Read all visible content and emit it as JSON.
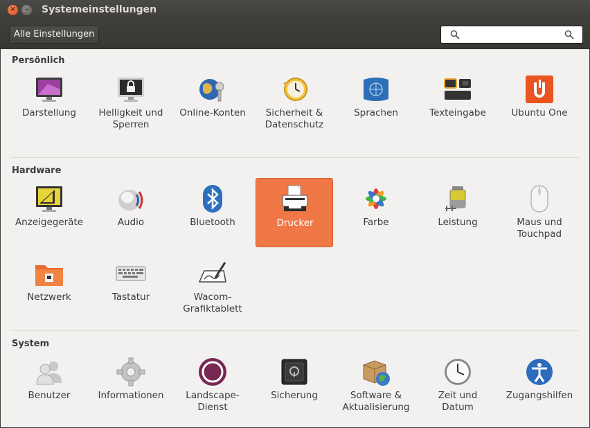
{
  "window": {
    "title": "Systemeinstellungen",
    "close_glyph": "×",
    "minimize_glyph": "–"
  },
  "toolbar": {
    "all_settings_label": "Alle Einstellungen",
    "search_placeholder": "",
    "search_value": ""
  },
  "sections": {
    "personal": {
      "title": "Persönlich",
      "items": [
        {
          "icon": "appearance-icon",
          "label": [
            "Darstellung"
          ]
        },
        {
          "icon": "brightness-lock-icon",
          "label": [
            "Helligkeit und",
            "Sperren"
          ]
        },
        {
          "icon": "online-accounts-icon",
          "label": [
            "Online-Konten"
          ]
        },
        {
          "icon": "security-privacy-icon",
          "label": [
            "Sicherheit &",
            "Datenschutz"
          ]
        },
        {
          "icon": "languages-icon",
          "label": [
            "Sprachen"
          ]
        },
        {
          "icon": "text-entry-icon",
          "label": [
            "Texteingabe"
          ]
        },
        {
          "icon": "ubuntu-one-icon",
          "label": [
            "Ubuntu One"
          ]
        }
      ]
    },
    "hardware": {
      "title": "Hardware",
      "items": [
        {
          "icon": "displays-icon",
          "label": [
            "Anzeigegeräte"
          ]
        },
        {
          "icon": "audio-icon",
          "label": [
            "Audio"
          ]
        },
        {
          "icon": "bluetooth-icon",
          "label": [
            "Bluetooth"
          ]
        },
        {
          "icon": "printer-icon",
          "label": [
            "Drucker"
          ],
          "selected": true
        },
        {
          "icon": "color-icon",
          "label": [
            "Farbe"
          ]
        },
        {
          "icon": "power-icon",
          "label": [
            "Leistung"
          ]
        },
        {
          "icon": "mouse-icon",
          "label": [
            "Maus und",
            "Touchpad"
          ]
        },
        {
          "icon": "network-icon",
          "label": [
            "Netzwerk"
          ]
        },
        {
          "icon": "keyboard-icon",
          "label": [
            "Tastatur"
          ]
        },
        {
          "icon": "wacom-tablet-icon",
          "label": [
            "Wacom-",
            "Grafiktablett"
          ]
        }
      ]
    },
    "system": {
      "title": "System",
      "items": [
        {
          "icon": "users-icon",
          "label": [
            "Benutzer"
          ]
        },
        {
          "icon": "details-gear-icon",
          "label": [
            "Informationen"
          ]
        },
        {
          "icon": "landscape-icon",
          "label": [
            "Landscape-",
            "Dienst"
          ]
        },
        {
          "icon": "backup-safe-icon",
          "label": [
            "Sicherung"
          ]
        },
        {
          "icon": "software-updates-icon",
          "label": [
            "Software &",
            "Aktualisierung"
          ]
        },
        {
          "icon": "time-date-icon",
          "label": [
            "Zeit und",
            "Datum"
          ]
        },
        {
          "icon": "accessibility-icon",
          "label": [
            "Zugangshilfen"
          ]
        }
      ]
    }
  }
}
